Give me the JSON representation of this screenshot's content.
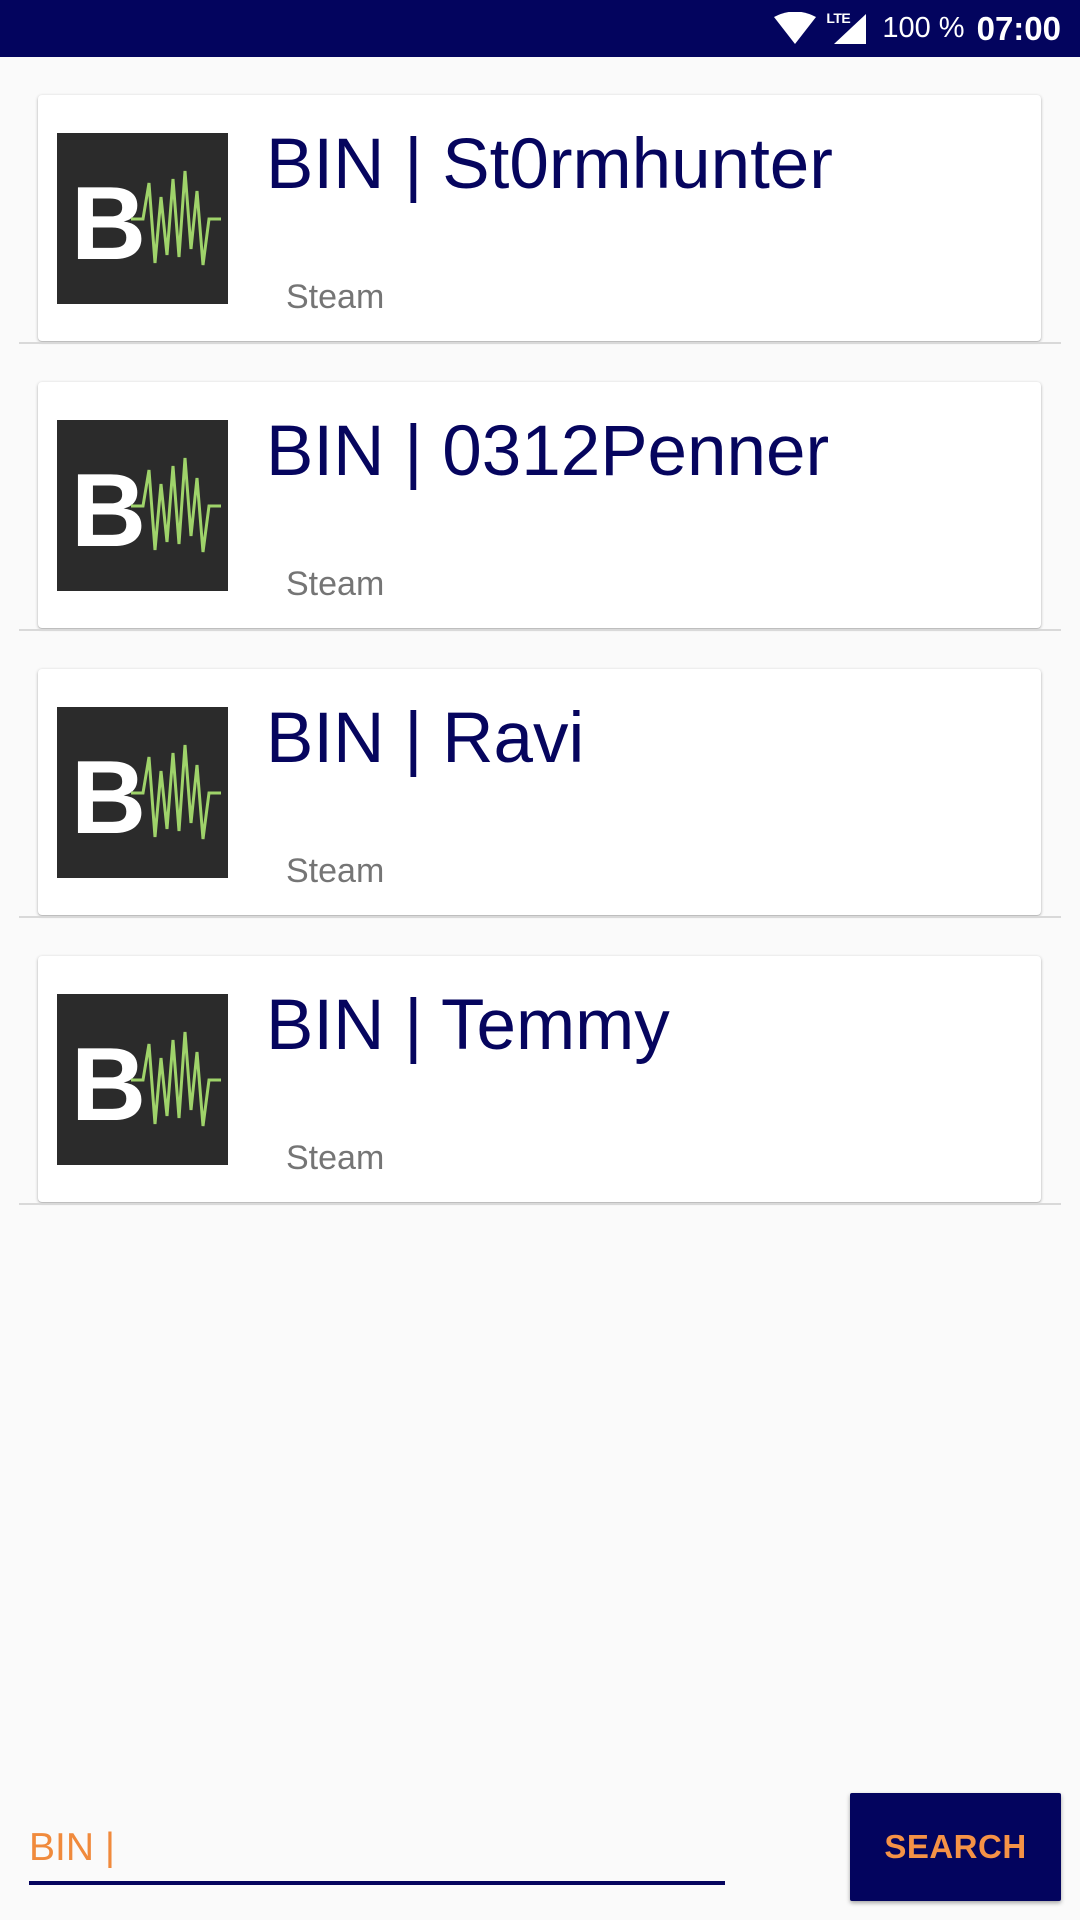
{
  "status_bar": {
    "network_label": "LTE",
    "battery": "100 %",
    "time": "07:00",
    "icons": [
      "wifi-icon",
      "signal-icon"
    ]
  },
  "results": [
    {
      "title": "BIN | St0rmhunter",
      "subtitle": "Steam",
      "logo_letter": "B"
    },
    {
      "title": "BIN | 0312Penner",
      "subtitle": "Steam",
      "logo_letter": "B"
    },
    {
      "title": "BIN | Ravi",
      "subtitle": "Steam",
      "logo_letter": "B"
    },
    {
      "title": "BIN | Temmy",
      "subtitle": "Steam",
      "logo_letter": "B"
    }
  ],
  "search": {
    "value": "BIN |",
    "button_label": "SEARCH"
  },
  "colors": {
    "primary": "#03045e",
    "title_text": "#06055e",
    "accent": "#f59246",
    "logo_background": "#2b2b2b",
    "logo_wave": "#9fd36a",
    "cursor": "#e91e63"
  }
}
